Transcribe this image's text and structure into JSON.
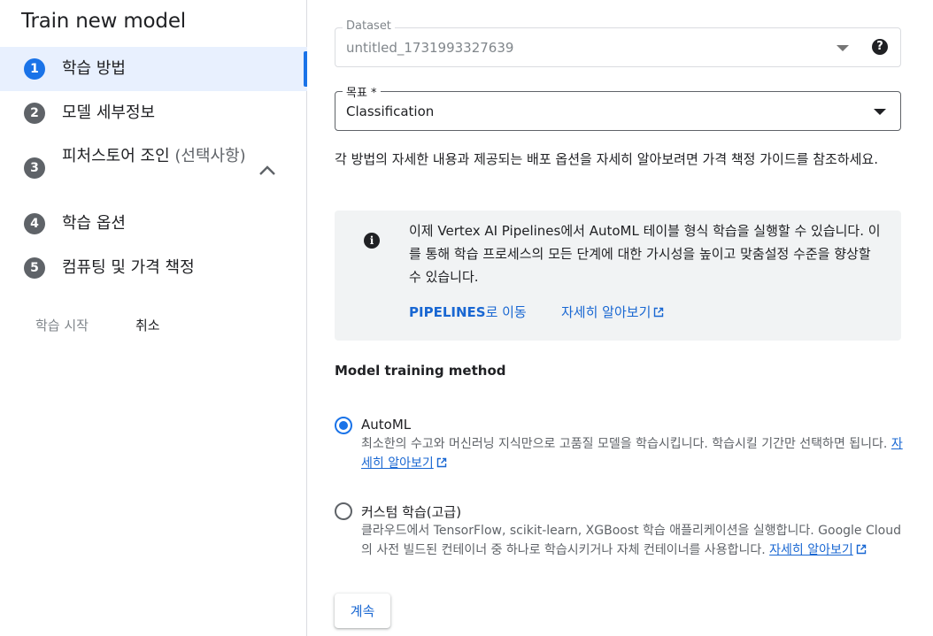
{
  "panel": {
    "title": "Train new model",
    "steps": [
      {
        "num": "1",
        "label": "학습 방법"
      },
      {
        "num": "2",
        "label": "모델 세부정보"
      },
      {
        "num": "3",
        "label": "피처스토어 조인",
        "label_optional": "(선택사항)"
      },
      {
        "num": "4",
        "label": "학습 옵션"
      },
      {
        "num": "5",
        "label": "컴퓨팅 및 가격 책정"
      }
    ],
    "start_label": "학습 시작",
    "cancel_label": "취소"
  },
  "form": {
    "dataset_label": "Dataset",
    "dataset_value": "untitled_1731993327639",
    "goal_label": "목표 *",
    "goal_value": "Classification",
    "description": "각 방법의 자세한 내용과 제공되는 배포 옵션을 자세히 알아보려면 가격 책정 가이드를 참조하세요.",
    "info": {
      "text": "이제 Vertex AI Pipelines에서 AutoML 테이블 형식 학습을 실행할 수 있습니다. 이를 통해 학습 프로세스의 모든 단계에 대한 가시성을 높이고 맞춤설정 수준을 향상할 수 있습니다.",
      "pipelines_link_bold": "PIPELINES",
      "pipelines_link_rest": "로 이동",
      "learn_more": "자세히 알아보기"
    },
    "section_title": "Model training method",
    "options": [
      {
        "title": "AutoML",
        "desc": "최소한의 수고와 머신러닝 지식만으로 고품질 모델을 학습시킵니다. 학습시킬 기간만 선택하면 됩니다.",
        "link": "자세히 알아보기",
        "checked": true
      },
      {
        "title": "커스텀 학습(고급)",
        "desc": "클라우드에서 TensorFlow, scikit-learn, XGBoost 학습 애플리케이션을 실행합니다. Google Cloud의 사전 빌드된 컨테이너 중 하나로 학습시키거나 자체 컨테이너를 사용합니다.",
        "link": "자세히 알아보기",
        "checked": false
      }
    ],
    "continue_label": "계속"
  },
  "colors": {
    "accent": "#1a73e8",
    "link": "#1967d2",
    "active_step_bg": "#e8f0fe",
    "info_bg": "#f1f3f4"
  }
}
